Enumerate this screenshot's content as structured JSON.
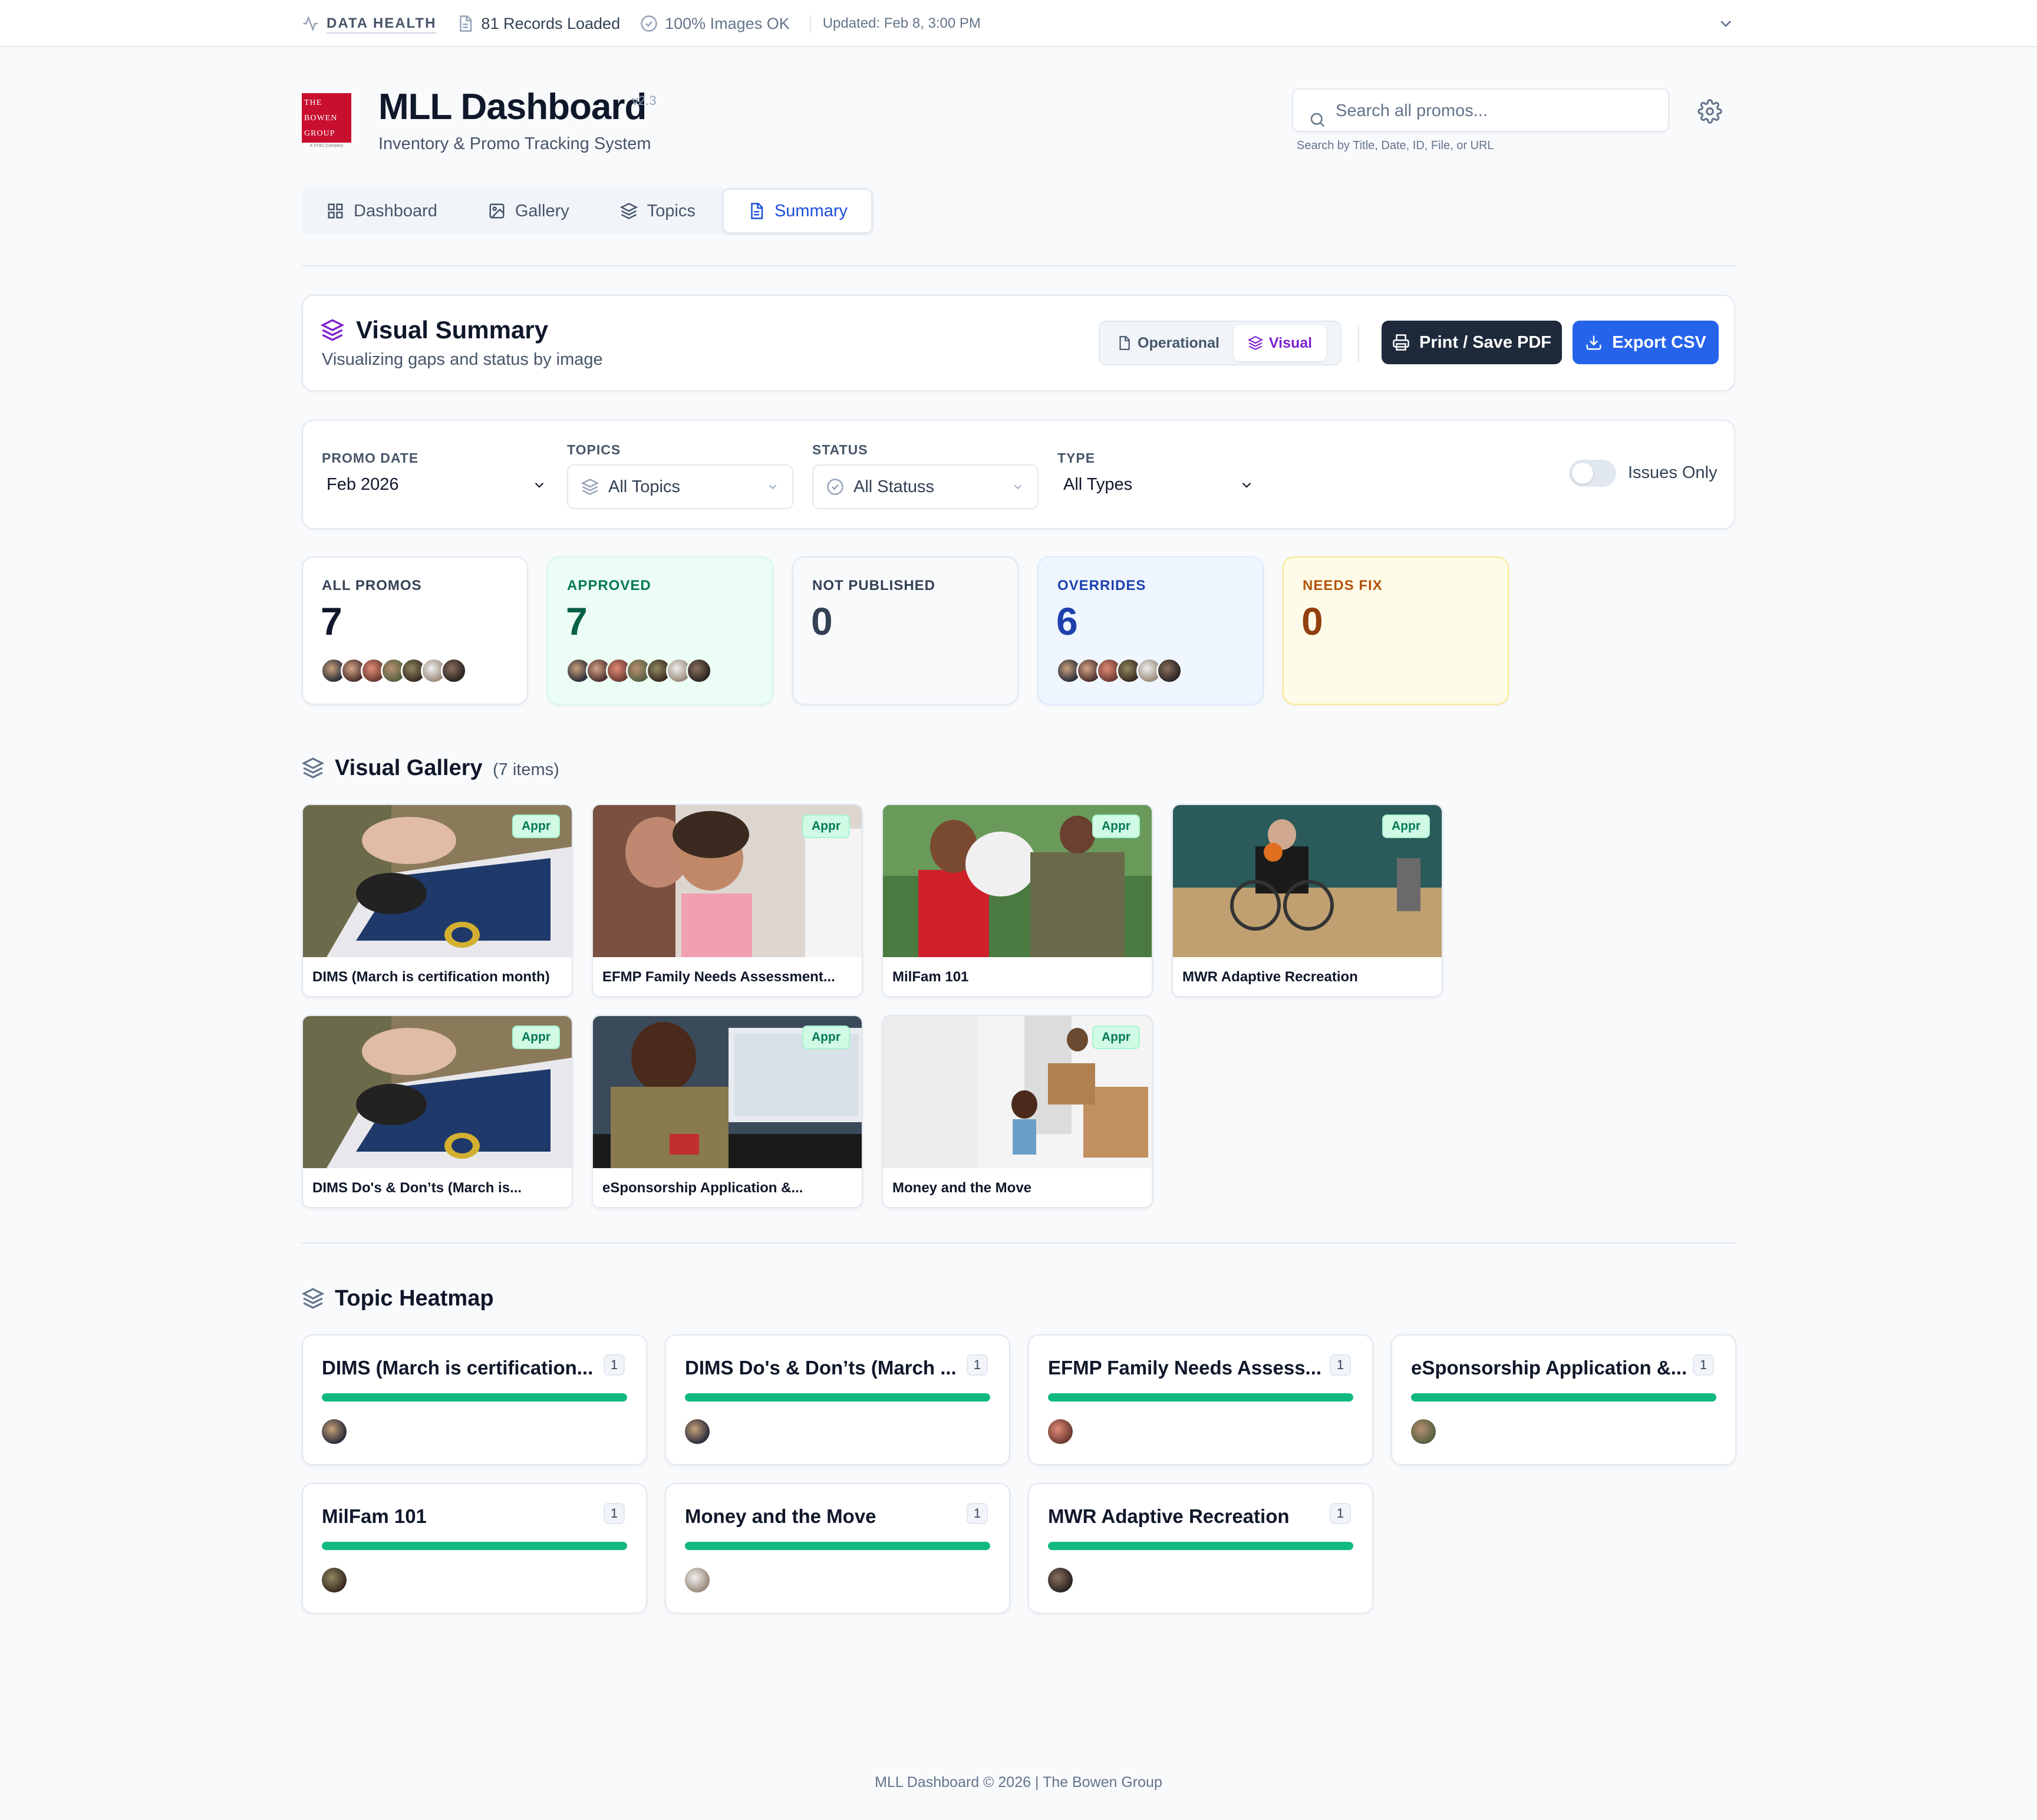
{
  "topbar": {
    "health_label": "DATA HEALTH",
    "records": "81 Records Loaded",
    "images": "100% Images OK",
    "updated": "Updated: Feb 8, 3:00 PM"
  },
  "header": {
    "logo_line1": "THE",
    "logo_line2": "BOWEN",
    "logo_line3": "GROUP",
    "logo_sub": "A ST&C Company",
    "title": "MLL Dashboard",
    "version": "v2.3",
    "subtitle": "Inventory & Promo Tracking System",
    "search_placeholder": "Search all promos...",
    "search_hint": "Search by Title, Date, ID, File, or URL"
  },
  "nav": {
    "tabs": [
      {
        "label": "Dashboard",
        "icon": "grid-icon",
        "active": false
      },
      {
        "label": "Gallery",
        "icon": "image-icon",
        "active": false
      },
      {
        "label": "Topics",
        "icon": "layers-icon",
        "active": false
      },
      {
        "label": "Summary",
        "icon": "document-icon",
        "active": true
      }
    ]
  },
  "visual_summary": {
    "title": "Visual Summary",
    "subtitle": "Visualizing gaps and status by image",
    "mode_operational": "Operational",
    "mode_visual": "Visual",
    "print_label": "Print / Save PDF",
    "export_label": "Export CSV"
  },
  "filters": {
    "promo_date_label": "PROMO DATE",
    "promo_date_value": "Feb 2026",
    "topics_label": "TOPICS",
    "topics_value": "All Topics",
    "status_label": "STATUS",
    "status_value": "All Statuss",
    "type_label": "TYPE",
    "type_value": "All Types",
    "issues_only_label": "Issues Only",
    "issues_only_on": false
  },
  "stats": [
    {
      "label": "ALL PROMOS",
      "value": "7",
      "thumb_count": 7
    },
    {
      "label": "APPROVED",
      "value": "7",
      "thumb_count": 7
    },
    {
      "label": "NOT PUBLISHED",
      "value": "0",
      "thumb_count": 0
    },
    {
      "label": "OVERRIDES",
      "value": "6",
      "thumb_count": 6
    },
    {
      "label": "NEEDS FIX",
      "value": "0",
      "thumb_count": 0
    }
  ],
  "gallery": {
    "title": "Visual Gallery",
    "count": "(7 items)",
    "items": [
      {
        "caption": "DIMS (March is certification month)",
        "badge": "Appr"
      },
      {
        "caption": "EFMP Family Needs Assessment...",
        "badge": "Appr"
      },
      {
        "caption": "MilFam 101",
        "badge": "Appr"
      },
      {
        "caption": "MWR Adaptive Recreation",
        "badge": "Appr"
      },
      {
        "caption": "DIMS Do's & Don’ts (March is...",
        "badge": "Appr"
      },
      {
        "caption": "eSponsorship Application &...",
        "badge": "Appr"
      },
      {
        "caption": "Money and the Move",
        "badge": "Appr"
      }
    ]
  },
  "heatmap": {
    "title": "Topic Heatmap",
    "items": [
      {
        "title": "DIMS (March is certification...",
        "count": "1",
        "fill": 1.0
      },
      {
        "title": "DIMS Do's & Don’ts (March ...",
        "count": "1",
        "fill": 1.0
      },
      {
        "title": "EFMP Family Needs Assess...",
        "count": "1",
        "fill": 1.0
      },
      {
        "title": "eSponsorship Application &...",
        "count": "1",
        "fill": 1.0
      },
      {
        "title": "MilFam 101",
        "count": "1",
        "fill": 1.0
      },
      {
        "title": "Money and the Move",
        "count": "1",
        "fill": 1.0
      },
      {
        "title": "MWR Adaptive Recreation",
        "count": "1",
        "fill": 1.0
      }
    ]
  },
  "footer": {
    "text": "MLL Dashboard © 2026 | The Bowen Group"
  },
  "colors": {
    "accent_blue": "#2563eb",
    "accent_purple": "#7e22ce",
    "approved_green": "#047857",
    "overrides_blue": "#1e40af",
    "needs_fix_amber": "#b45309",
    "bar_green": "#10b981"
  }
}
